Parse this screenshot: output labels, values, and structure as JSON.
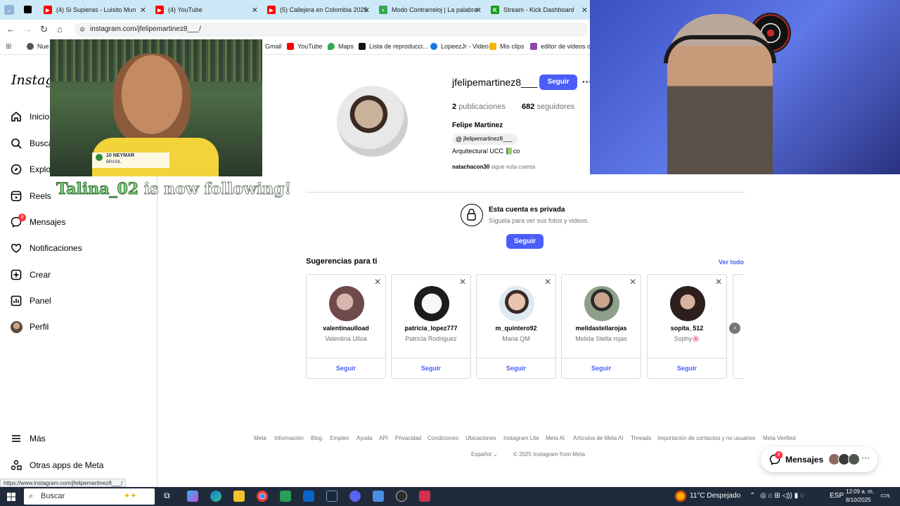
{
  "browser": {
    "tabs": [
      {
        "title": "(4) Si Supieras - Luisito Mun",
        "color": "#ff0000"
      },
      {
        "title": "(4) YouTube",
        "color": "#ff0000"
      },
      {
        "title": "(5) Callejera en Colombia 2025",
        "color": "#ff0000"
      },
      {
        "title": "Modo Contrarreloj | La palabra",
        "color": "#34a853"
      },
      {
        "title": "Stream - Kick Dashboard",
        "color": "#53fc18"
      }
    ],
    "url": "instagram.com/jfelipemartinez8___/",
    "bookmarks": [
      "Nue",
      "Gmail",
      "YouTube",
      "Maps",
      "Lista de reproducci...",
      "LopeezJr - Video",
      "Mis clips",
      "editor de videos onl"
    ]
  },
  "sidebar": {
    "logo": "Instagram",
    "items": [
      {
        "label": "Inicio",
        "icon": "home-icon"
      },
      {
        "label": "Buscar",
        "icon": "search-icon"
      },
      {
        "label": "Explorar",
        "icon": "compass-icon"
      },
      {
        "label": "Reels",
        "icon": "reels-icon"
      },
      {
        "label": "Mensajes",
        "icon": "messenger-icon",
        "badge": "8"
      },
      {
        "label": "Notificaciones",
        "icon": "heart-icon"
      },
      {
        "label": "Crear",
        "icon": "plus-icon"
      },
      {
        "label": "Panel",
        "icon": "chart-icon"
      },
      {
        "label": "Perfil",
        "icon": "avatar-icon"
      }
    ],
    "more": "Más",
    "other_apps": "Otras apps de Meta"
  },
  "profile": {
    "username": "jfelipemartinez8___",
    "follow_label": "Seguir",
    "more_label": "···",
    "posts_count": "2",
    "posts_label": "publicaciones",
    "followers_count": "682",
    "followers_label": "seguidores",
    "full_name": "Felipe Martinez",
    "threads_handle": "jfelipemartinez8___",
    "bio": "Arquitectura/ UCC 📗co",
    "followed_by_user": "natachacon30",
    "followed_by_text": "sigue esta cuenta"
  },
  "private_notice": {
    "title": "Esta cuenta es privada",
    "subtitle": "Síguela para ver sus fotos y videos.",
    "follow_label": "Seguir"
  },
  "suggestions": {
    "title": "Sugerencias para ti",
    "see_all": "Ver todo",
    "close_label": "✕",
    "cards": [
      {
        "username": "valentinaulload",
        "name": "Valentina Ulloa",
        "follow": "Seguir",
        "avatar_color": "#a07a78"
      },
      {
        "username": "patricia_lopez777",
        "name": "Patricia Rodriguez",
        "follow": "Seguir",
        "avatar_color": "#e8e8e8"
      },
      {
        "username": "m_quintero92",
        "name": "Maria QM",
        "follow": "Seguir",
        "avatar_color": "#d8b7a4"
      },
      {
        "username": "melidastellarojas",
        "name": "Melida Stella rojas",
        "follow": "Seguir",
        "avatar_color": "#7c8a78"
      },
      {
        "username": "sopita_512",
        "name": "Sophy🌸",
        "follow": "Seguir",
        "avatar_color": "#5a3f3a"
      }
    ],
    "next_label": "›"
  },
  "footer": {
    "links": [
      "Meta",
      "Información",
      "Blog",
      "Empleo",
      "Ayuda",
      "API",
      "Privacidad",
      "Condiciones",
      "Ubicaciones",
      "Instagram Lite",
      "Meta AI",
      "Artículos de Meta AI",
      "Threads",
      "Importación de contactos y no usuarios",
      "Meta Verified"
    ],
    "language": "Español",
    "copyright": "© 2025 Instagram from Meta"
  },
  "messages_pill": {
    "label": "Mensajes",
    "badge": "8"
  },
  "stream_overlay": {
    "follow_alert_user": "Talina_02",
    "follow_alert_text": "is now following!",
    "lower_third_number": "10 NEYMAR",
    "lower_third_team": "BRASIL"
  },
  "status_url": "https://www.instagram.com/jfelipemartinez8___/",
  "taskbar": {
    "search_placeholder": "Buscar",
    "weather": "11°C  Despejado",
    "language": "ESP",
    "time": "12:09 a. m.",
    "date": "8/10/2025",
    "notifications": "5"
  }
}
